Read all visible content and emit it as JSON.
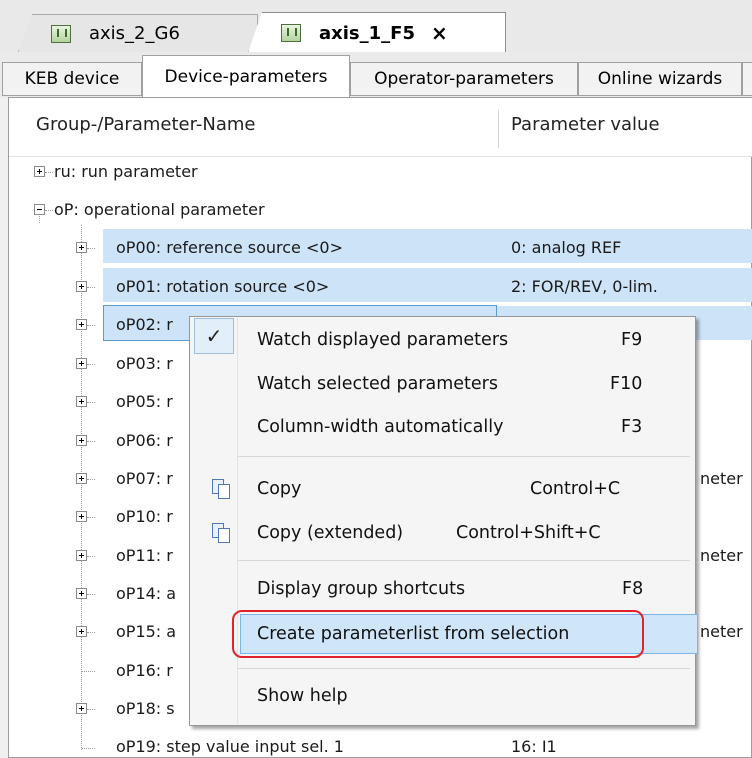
{
  "document_tabs": [
    {
      "label": "axis_2_G6"
    },
    {
      "label": "axis_1_F5",
      "close": "×"
    }
  ],
  "sub_tabs": [
    "KEB device",
    "Device-parameters",
    "Operator-parameters",
    "Online wizards"
  ],
  "columns": {
    "name": "Group-/Parameter-Name",
    "value": "Parameter value"
  },
  "tree": {
    "ru": "ru: run parameter",
    "oP": "oP: operational parameter",
    "rows": [
      {
        "name": "oP00: reference source <0>",
        "value": "0: analog REF"
      },
      {
        "name": "oP01: rotation source <0>",
        "value": "2: FOR/REV, 0-lim."
      },
      {
        "name": "oP02: r",
        "value": ""
      },
      {
        "name": "oP03: r",
        "value": ""
      },
      {
        "name": "oP05: r",
        "value": ""
      },
      {
        "name": "oP06: r",
        "value": ""
      },
      {
        "name": "oP07: r",
        "value": "neter"
      },
      {
        "name": "oP10: r",
        "value": ""
      },
      {
        "name": "oP11: r",
        "value": "neter"
      },
      {
        "name": "oP14: a",
        "value": ""
      },
      {
        "name": "oP15: a",
        "value": "neter"
      },
      {
        "name": "oP16: r",
        "value": ""
      },
      {
        "name": "oP18: s",
        "value": ""
      },
      {
        "name": "oP19: step value input sel. 1",
        "value": "16: I1"
      }
    ]
  },
  "context_menu": {
    "items": [
      {
        "label": "Watch displayed parameters",
        "shortcut": "F9"
      },
      {
        "label": "Watch selected parameters",
        "shortcut": "F10"
      },
      {
        "label": "Column-width automatically",
        "shortcut": "F3"
      },
      {
        "label": "Copy",
        "shortcut": "Control+C"
      },
      {
        "label": "Copy (extended)",
        "shortcut": "Control+Shift+C"
      },
      {
        "label": "Display group shortcuts",
        "shortcut": "F8"
      },
      {
        "label": "Create parameterlist from selection",
        "shortcut": ""
      },
      {
        "label": "Show help",
        "shortcut": ""
      }
    ],
    "check_mark": "✓"
  },
  "colors": {
    "selection": "#cde3f7",
    "highlight_outline": "#e0242a"
  }
}
